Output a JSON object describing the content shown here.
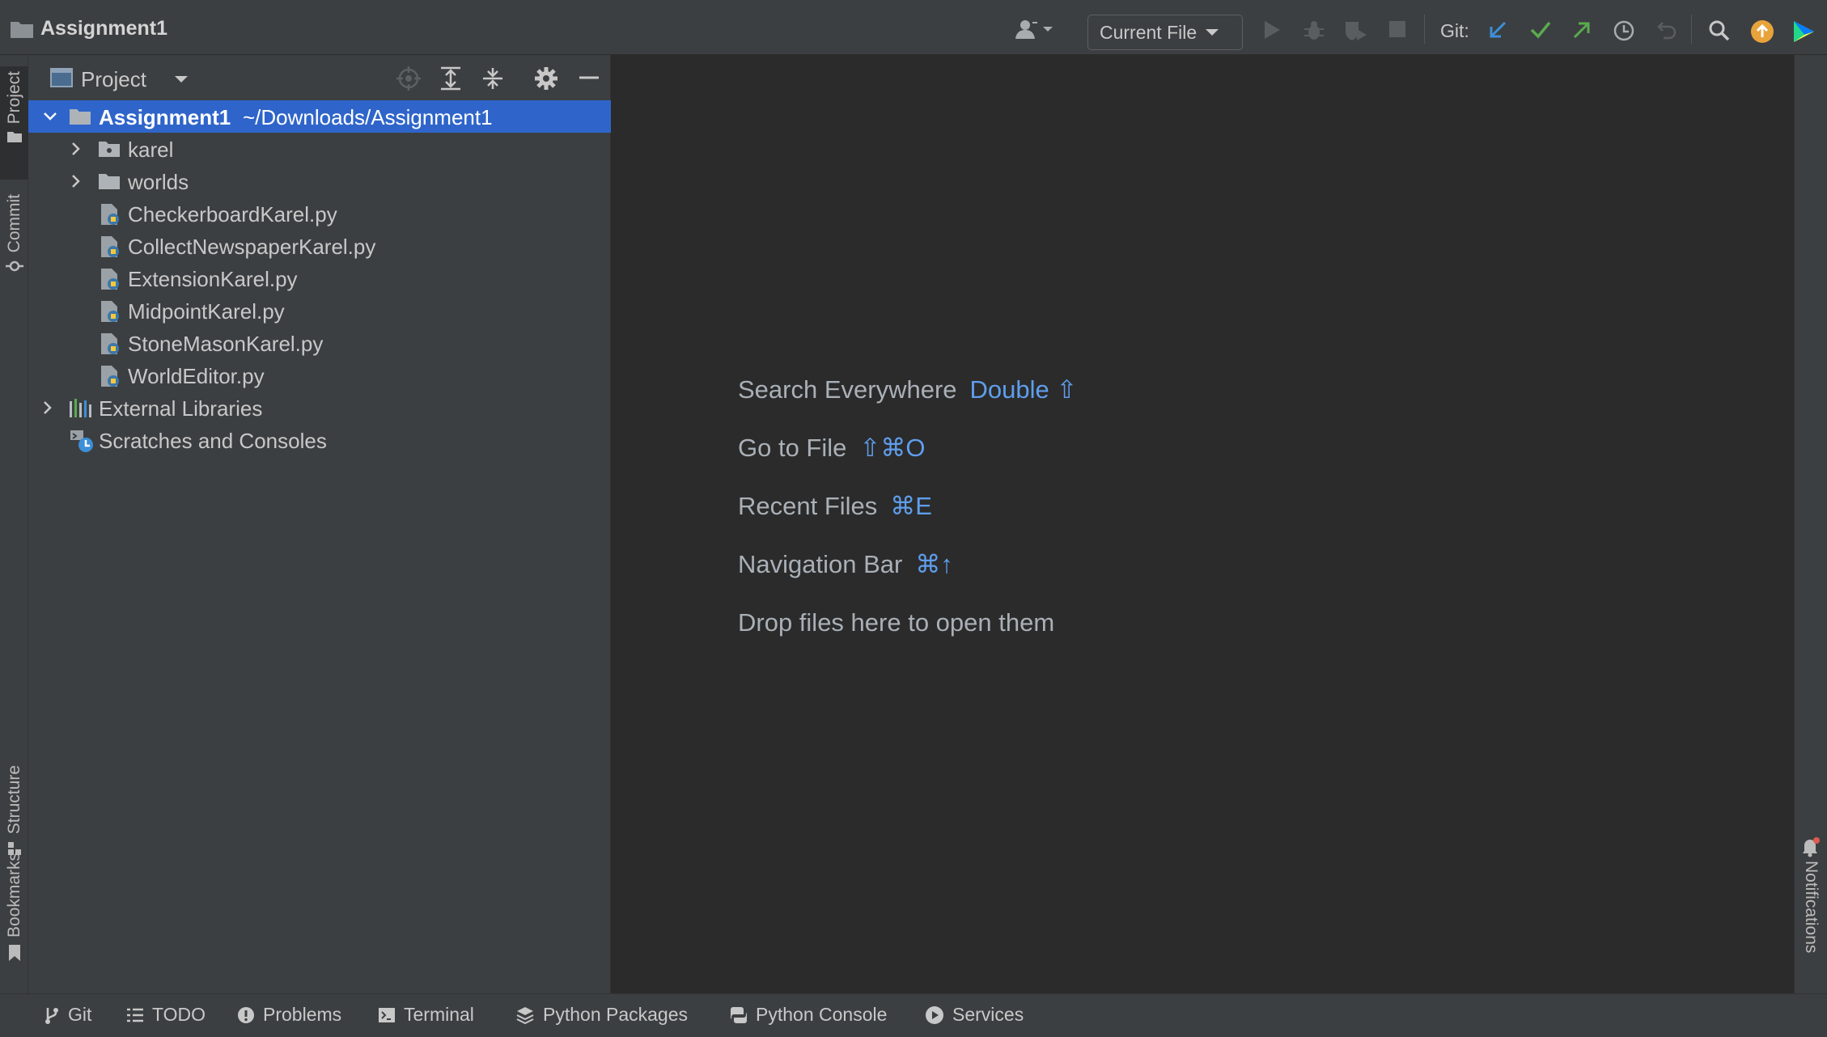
{
  "window": {
    "title": "Assignment1"
  },
  "toolbar": {
    "run_config": "Current File",
    "git_label": "Git:"
  },
  "left_strip": {
    "project": "Project",
    "commit": "Commit",
    "structure": "Structure",
    "bookmarks": "Bookmarks"
  },
  "right_strip": {
    "notifications": "Notifications"
  },
  "project_panel": {
    "title": "Project",
    "root": {
      "name": "Assignment1",
      "path": "~/Downloads/Assignment1"
    },
    "folders": [
      "karel",
      "worlds"
    ],
    "files": [
      "CheckerboardKarel.py",
      "CollectNewspaperKarel.py",
      "ExtensionKarel.py",
      "MidpointKarel.py",
      "StoneMasonKarel.py",
      "WorldEditor.py"
    ],
    "external_libraries": "External Libraries",
    "scratches": "Scratches and Consoles"
  },
  "editor": {
    "hints": [
      {
        "label": "Search Everywhere",
        "key": "Double ⇧"
      },
      {
        "label": "Go to File",
        "key": "⇧⌘O"
      },
      {
        "label": "Recent Files",
        "key": "⌘E"
      },
      {
        "label": "Navigation Bar",
        "key": "⌘↑"
      }
    ],
    "drop_text": "Drop files here to open them"
  },
  "bottom_tabs": [
    "Git",
    "TODO",
    "Problems",
    "Terminal",
    "Python Packages",
    "Python Console",
    "Services"
  ],
  "colors": {
    "accent_blue": "#2f65ca",
    "hint_key_blue": "#5f9eed",
    "git_update_blue": "#3d8fd8",
    "git_commit_green": "#5aab4e",
    "git_push_green": "#5aab4e",
    "update_orange": "#e8a33b"
  },
  "icons": [
    "folder-icon",
    "user-icon",
    "run-icon",
    "debug-icon",
    "coverage-icon",
    "stop-icon",
    "git-update-icon",
    "git-commit-icon",
    "git-push-icon",
    "history-icon",
    "rollback-icon",
    "search-icon",
    "ide-update-icon",
    "jetbrains-logo-icon",
    "python-file-icon",
    "library-icon",
    "scratches-icon",
    "notifications-bell-icon"
  ]
}
